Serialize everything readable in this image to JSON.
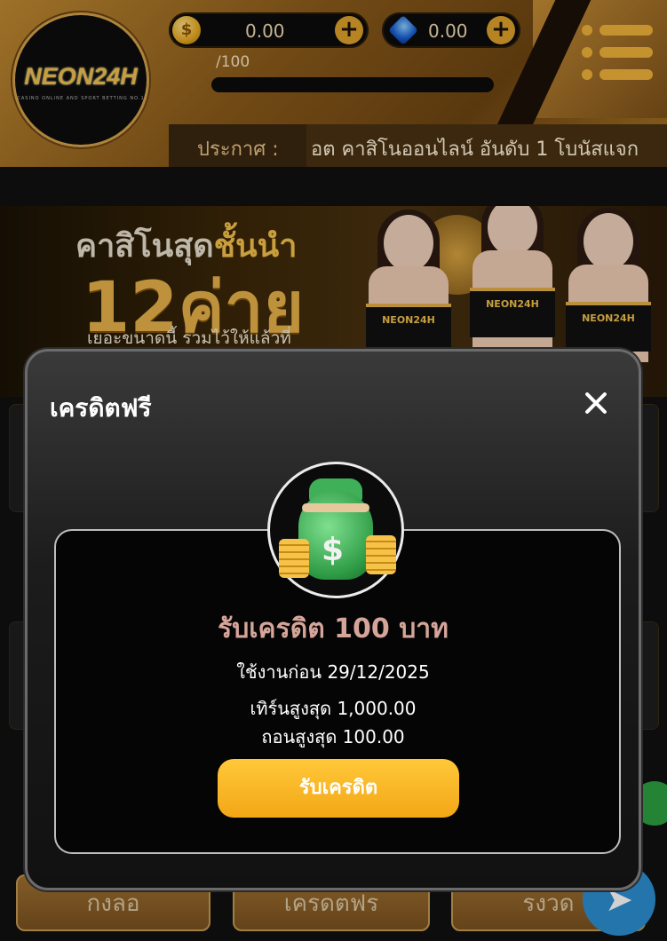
{
  "header": {
    "logo_text": "NEON24H",
    "logo_subtitle": "CASINO ONLINE AND SPORT BETTING NO.1",
    "coin_balance": "0.00",
    "gem_balance": "0.00",
    "coin_icon_glyph": "$",
    "plus_glyph": "+",
    "progress_text": "/100",
    "progress_value": 0
  },
  "ticker": {
    "label": "ประกาศ :",
    "message": "อต คาสิโนออนไลน์ อันดับ 1 โบนัสแจก"
  },
  "banner": {
    "line1_a": "คาสิโนสุด",
    "line1_b": "ชั้นนำ",
    "line2": "12ค่าย",
    "line3": "เยอะขนาดนี้ รวมไว้ให้แล้วที่",
    "tag": "NEON24H"
  },
  "bottom_nav": {
    "tab1": "กงลอ",
    "tab2": "เครดตฟร",
    "tab3": "รงวด"
  },
  "modal": {
    "title": "เครดิตฟรี",
    "credit_title": "รับเครดิต 100 บาท",
    "use_before": "ใช้งานก่อน 29/12/2025",
    "max_turnover": "เทิร์นสูงสุด 1,000.00",
    "max_withdraw": "ถอนสูงสุด 100.00",
    "claim_label": "รับเครดิต",
    "bag_symbol": "$"
  },
  "icons": {
    "close": "close-icon",
    "menu": "hamburger-menu-icon",
    "coin": "coin-icon",
    "gem": "gem-icon",
    "money_bag": "money-bag-icon",
    "telegram": "telegram-icon"
  },
  "colors": {
    "accent_gold": "#f0b43a",
    "claim_button": "#f7b322",
    "credit_title": "#d6a59a",
    "modal_bg": "#111111"
  }
}
